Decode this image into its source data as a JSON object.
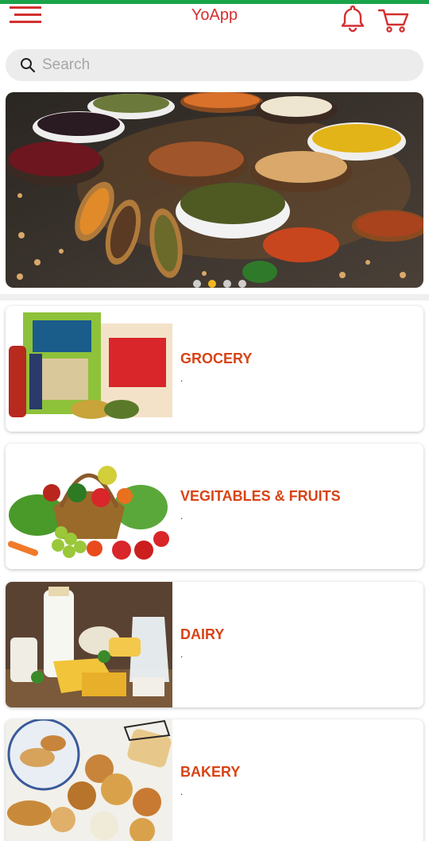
{
  "app": {
    "title": "YoApp"
  },
  "header": {
    "menu_icon": "hamburger-menu-icon",
    "bell_icon": "bell-icon",
    "cart_icon": "cart-icon"
  },
  "search": {
    "placeholder": "Search",
    "value": "",
    "icon": "search-icon"
  },
  "carousel": {
    "slide_count": 4,
    "active_index": 1
  },
  "colors": {
    "brand": "#d32f2f",
    "top_bar": "#1aa34a",
    "category_text": "#d84315",
    "dot_active": "#f3b61f"
  },
  "categories": [
    {
      "label": "GROCERY",
      "subtitle": "."
    },
    {
      "label": "VEGITABLES & FRUITS",
      "subtitle": "."
    },
    {
      "label": "DAIRY",
      "subtitle": "."
    },
    {
      "label": "BAKERY",
      "subtitle": "."
    }
  ]
}
